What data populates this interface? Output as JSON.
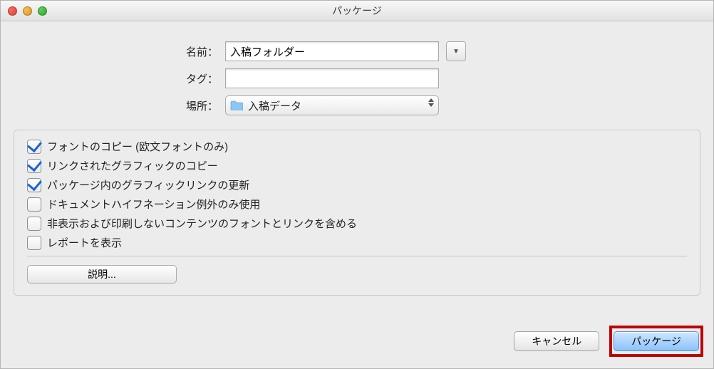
{
  "window": {
    "title": "パッケージ"
  },
  "fields": {
    "name_label": "名前：",
    "name_value": "入稿フォルダー",
    "tag_label": "タグ：",
    "tag_value": "",
    "location_label": "場所：",
    "location_value": "入稿データ"
  },
  "options": {
    "items": [
      {
        "label": "フォントのコピー (欧文フォントのみ)",
        "checked": true
      },
      {
        "label": "リンクされたグラフィックのコピー",
        "checked": true
      },
      {
        "label": "パッケージ内のグラフィックリンクの更新",
        "checked": true
      },
      {
        "label": "ドキュメントハイフネーション例外のみ使用",
        "checked": false
      },
      {
        "label": "非表示および印刷しないコンテンツのフォントとリンクを含める",
        "checked": false
      },
      {
        "label": "レポートを表示",
        "checked": false
      }
    ],
    "description_button": "説明..."
  },
  "footer": {
    "cancel": "キャンセル",
    "package": "パッケージ"
  }
}
